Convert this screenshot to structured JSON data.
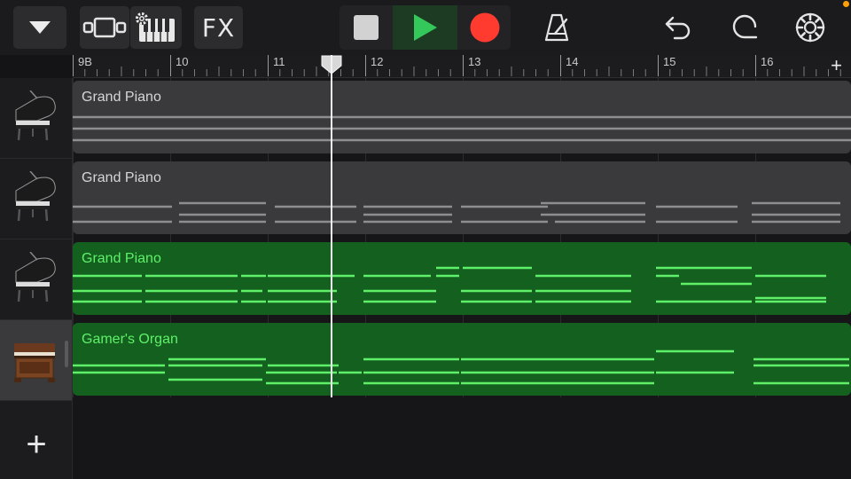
{
  "toolbar": {
    "fx_label": "FX"
  },
  "ruler": {
    "bars": [
      "9B",
      "10",
      "11",
      "12",
      "13",
      "14",
      "15",
      "16"
    ]
  },
  "playhead_bar": 11.65,
  "tracks": [
    {
      "name": "Grand Piano",
      "icon": "grand-piano-icon",
      "selected": false,
      "region_color": "gray"
    },
    {
      "name": "Grand Piano",
      "icon": "grand-piano-icon",
      "selected": false,
      "region_color": "gray"
    },
    {
      "name": "Grand Piano",
      "icon": "grand-piano-icon",
      "selected": false,
      "region_color": "green"
    },
    {
      "name": "Gamer's Organ",
      "icon": "organ-icon",
      "selected": true,
      "region_color": "green"
    }
  ],
  "colors": {
    "record": "#ff3b30",
    "play": "#34c759",
    "region_green": "#14611f",
    "note_green": "#5ff06a",
    "region_gray": "#3a3a3c"
  }
}
